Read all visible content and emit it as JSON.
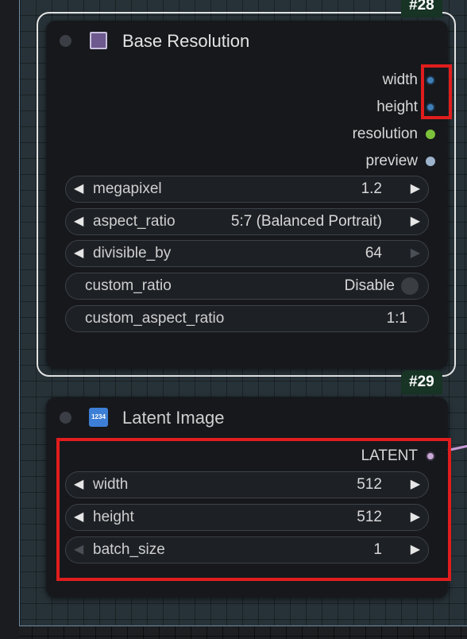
{
  "nodes": {
    "base_resolution": {
      "badge": "#28",
      "title": "Base Resolution",
      "outputs": [
        {
          "label": "width",
          "color": "#3f7fb8"
        },
        {
          "label": "height",
          "color": "#3f7fb8"
        },
        {
          "label": "resolution",
          "color": "#7cc23a"
        },
        {
          "label": "preview",
          "color": "#9db3cc"
        }
      ],
      "widgets": {
        "megapixel": {
          "label": "megapixel",
          "value": "1.2"
        },
        "aspect_ratio": {
          "label": "aspect_ratio",
          "value": "5:7 (Balanced Portrait)"
        },
        "divisible_by": {
          "label": "divisible_by",
          "value": "64"
        },
        "custom_ratio": {
          "label": "custom_ratio",
          "value": "Disable"
        },
        "custom_aspect_ratio": {
          "label": "custom_aspect_ratio",
          "value": "1:1"
        }
      }
    },
    "latent_image": {
      "badge": "#29",
      "icon_text": "1234",
      "title": "Latent Image",
      "outputs": [
        {
          "label": "LATENT",
          "color": "#c9a9d6"
        }
      ],
      "widgets": {
        "width": {
          "label": "width",
          "value": "512"
        },
        "height": {
          "label": "height",
          "value": "512"
        },
        "batch_size": {
          "label": "batch_size",
          "value": "1"
        }
      }
    }
  },
  "icons": {
    "left_arrow": "◀",
    "right_arrow": "▶"
  },
  "colors": {
    "highlight": "#e01d1d",
    "badge_bg": "#173425",
    "node_bg": "#16181c",
    "wire_latent": "#c79ad8"
  }
}
